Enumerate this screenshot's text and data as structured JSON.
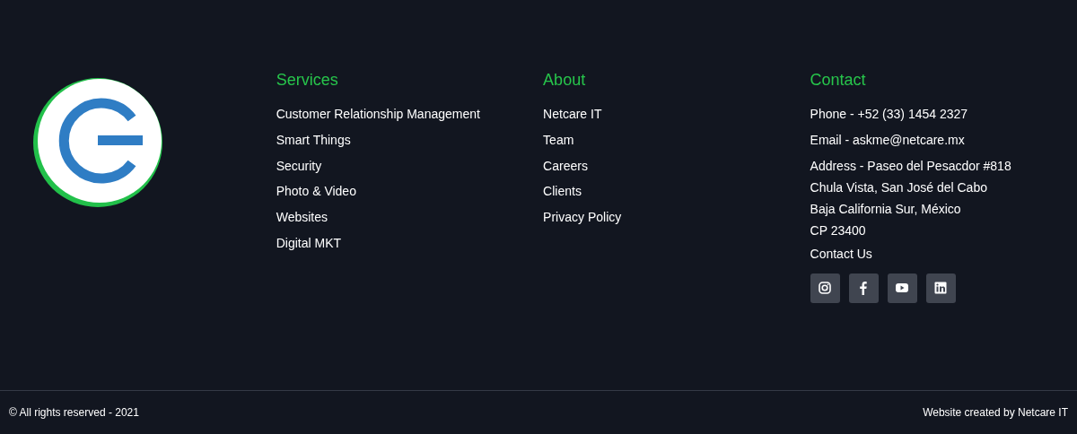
{
  "columns": [
    {
      "heading": "Services",
      "links": [
        "Customer Relationship Management",
        "Smart Things",
        "Security",
        "Photo & Video",
        "Websites",
        "Digital MKT"
      ]
    },
    {
      "heading": "About",
      "links": [
        "Netcare IT",
        "Team",
        "Careers",
        "Clients",
        "Privacy Policy"
      ]
    }
  ],
  "contact": {
    "heading": "Contact",
    "items": [
      {
        "lines": [
          "Phone - +52 (33) 1454 2327"
        ]
      },
      {
        "lines": [
          "Email - askme@netcare.mx"
        ]
      },
      {
        "lines": [
          "Address - Paseo del Pesacdor #818",
          "Chula Vista, San José del Cabo",
          "Baja California Sur, México",
          "CP 23400"
        ]
      },
      {
        "lines": [
          "Contact Us"
        ]
      }
    ],
    "social": [
      {
        "kind": "instagram"
      },
      {
        "kind": "facebook"
      },
      {
        "kind": "youtube"
      },
      {
        "kind": "linkedin"
      }
    ]
  },
  "bottom_bar": {
    "copyright": "© All rights reserved - 2021",
    "credit": "Website created by Netcare IT"
  }
}
